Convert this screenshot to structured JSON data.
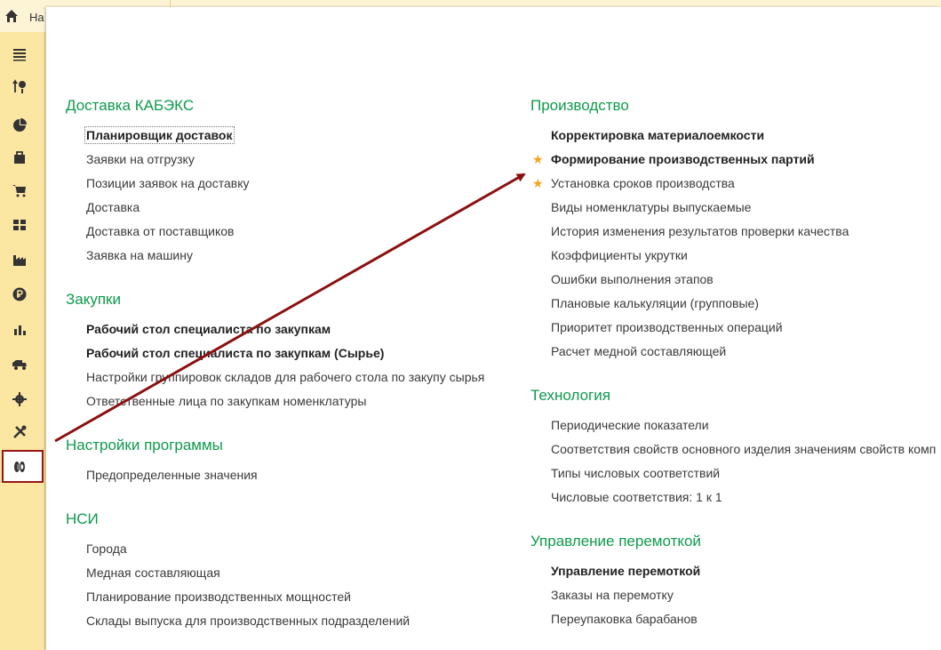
{
  "topbar": {
    "home_label": "На"
  },
  "sidebar": {
    "icons": [
      "menu-icon",
      "history-icon",
      "pie-chart-icon",
      "bag-icon",
      "cart-icon",
      "grid-icon",
      "factory-icon",
      "ruble-icon",
      "bar-chart-icon",
      "truck-icon",
      "gear-icon",
      "tools-icon",
      "cable-reel-icon"
    ],
    "active": "cable-reel-icon"
  },
  "colors": {
    "section_title": "#0f9a4c",
    "star": "#f3a521",
    "arrow": "#8b1010",
    "sidebar_bg": "#fbe6a2"
  },
  "left_column": [
    {
      "title": "Доставка КАБЭКС",
      "items": [
        {
          "label": "Планировщик доставок",
          "bold": true,
          "focused": true
        },
        {
          "label": "Заявки на отгрузку"
        },
        {
          "label": "Позиции заявок на доставку"
        },
        {
          "label": "Доставка"
        },
        {
          "label": "Доставка от поставщиков"
        },
        {
          "label": "Заявка на машину"
        }
      ]
    },
    {
      "title": "Закупки",
      "items": [
        {
          "label": "Рабочий стол специалиста по закупкам",
          "bold": true
        },
        {
          "label": "Рабочий стол специалиста по закупкам (Сырье)",
          "bold": true
        },
        {
          "label": "Настройки группировок складов для рабочего стола по закупу сырья"
        },
        {
          "label": "Ответственные лица по закупкам номенклатуры"
        }
      ]
    },
    {
      "title": "Настройки программы",
      "items": [
        {
          "label": "Предопределенные значения"
        }
      ]
    },
    {
      "title": "НСИ",
      "items": [
        {
          "label": "Города"
        },
        {
          "label": "Медная составляющая"
        },
        {
          "label": "Планирование производственных мощностей"
        },
        {
          "label": "Склады выпуска для производственных подразделений"
        }
      ]
    }
  ],
  "right_column": [
    {
      "title": "Производство",
      "items": [
        {
          "label": "Корректировка материалоемкости",
          "bold": true
        },
        {
          "label": "Формирование производственных партий",
          "bold": true,
          "star": true
        },
        {
          "label": "Установка сроков производства",
          "star": true
        },
        {
          "label": "Виды номенклатуры выпускаемые"
        },
        {
          "label": "История изменения результатов проверки качества"
        },
        {
          "label": "Коэффициенты укрутки"
        },
        {
          "label": "Ошибки выполнения этапов"
        },
        {
          "label": "Плановые калькуляции (групповые)"
        },
        {
          "label": "Приоритет производственных операций"
        },
        {
          "label": "Расчет медной составляющей"
        }
      ]
    },
    {
      "title": "Технология",
      "items": [
        {
          "label": "Периодические показатели"
        },
        {
          "label": "Соответствия свойств основного изделия значениям свойств комп"
        },
        {
          "label": "Типы числовых соответствий"
        },
        {
          "label": "Числовые соответствия: 1 к 1"
        }
      ]
    },
    {
      "title": "Управление перемоткой",
      "items": [
        {
          "label": "Управление перемоткой",
          "bold": true
        },
        {
          "label": "Заказы на перемотку"
        },
        {
          "label": "Переупаковка барабанов"
        }
      ]
    }
  ]
}
